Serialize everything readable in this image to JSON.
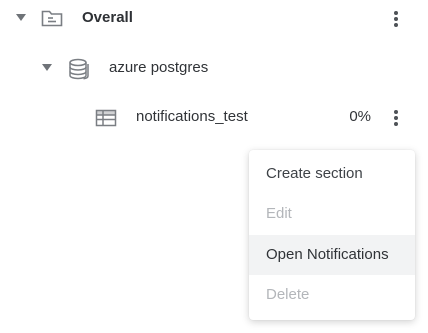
{
  "tree": {
    "overall": {
      "label": "Overall",
      "expanded": true,
      "icon": "folder-icon"
    },
    "database": {
      "label": "azure postgres",
      "expanded": true,
      "icon": "database-icon"
    },
    "table": {
      "label": "notifications_test",
      "progress": "0%",
      "icon": "table-icon"
    }
  },
  "context_menu": {
    "items": [
      {
        "label": "Create section",
        "enabled": true
      },
      {
        "label": "Edit",
        "enabled": false
      },
      {
        "label": "Open Notifications",
        "enabled": true,
        "highlighted": true
      },
      {
        "label": "Delete",
        "enabled": false
      }
    ]
  },
  "colors": {
    "text": "#303337",
    "disabled_text": "#b3b6ba",
    "icon": "#6f7378",
    "hover_bg": "#f2f3f4"
  }
}
